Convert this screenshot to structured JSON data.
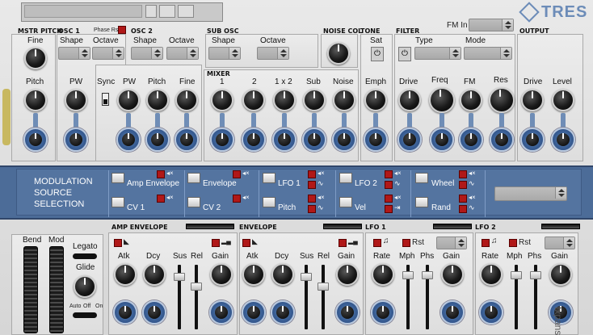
{
  "top": {
    "phase_rst": "Phase Rst",
    "fm_in": "FM In",
    "logo": "TRES"
  },
  "headers": {
    "mstr_pitch": "MSTR PITCH",
    "osc1": "OSC 1",
    "osc2": "OSC 2",
    "sub_osc": "SUB OSC",
    "noise_col": "NOISE COL",
    "tone": "TONE",
    "filter": "FILTER",
    "output": "OUTPUT",
    "mixer": "MIXER"
  },
  "labels": {
    "fine": "Fine",
    "pitch": "Pitch",
    "shape1": "Shape",
    "octave1": "Octave",
    "shape2": "Shape",
    "octave2": "Octave",
    "shape3": "Shape",
    "octave3": "Octave",
    "sat": "Sat",
    "type": "Type",
    "mode": "Mode",
    "pw1": "PW",
    "sync": "Sync",
    "pw2": "PW",
    "pitch2": "Pitch",
    "fine2": "Fine",
    "m1": "1",
    "m2": "2",
    "m12": "1 x 2",
    "msub": "Sub",
    "mnoise": "Noise",
    "emph": "Emph",
    "drive": "Drive",
    "freq": "Freq",
    "fm": "FM",
    "res": "Res",
    "odrive": "Drive",
    "level": "Level"
  },
  "modulation": {
    "title_l1": "MODULATION",
    "title_l2": "SOURCE",
    "title_l3": "SELECTION",
    "sources": [
      "Amp Envelope",
      "Envelope",
      "LFO 1",
      "LFO 2",
      "Wheel",
      "CV 1",
      "CV 2",
      "Pitch",
      "Vel",
      "Rand"
    ]
  },
  "bottom": {
    "amp_env": "AMP ENVELOPE",
    "env": "ENVELOPE",
    "lfo1": "LFO 1",
    "lfo2": "LFO 2",
    "bend": "Bend",
    "mod": "Mod",
    "legato": "Legato",
    "glide": "Glide",
    "auto": "Auto",
    "off": "Off",
    "on": "On",
    "atk": "Atk",
    "dcy": "Dcy",
    "sus": "Sus",
    "rel": "Rel",
    "gain": "Gain",
    "rate": "Rate",
    "mph": "Mph",
    "phs": "Phs",
    "rst": "Rst",
    "brand": "txpansion"
  }
}
